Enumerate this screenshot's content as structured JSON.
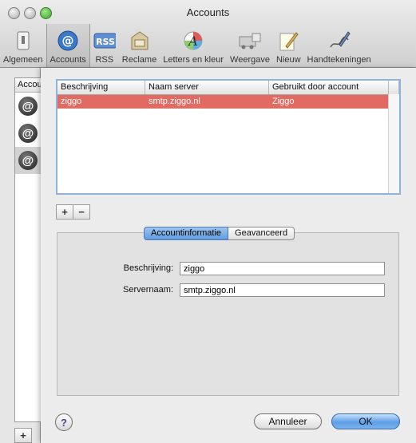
{
  "window": {
    "title": "Accounts"
  },
  "toolbar": {
    "items": [
      {
        "label": "Algemeen",
        "icon": "switch-icon"
      },
      {
        "label": "Accounts",
        "icon": "at-sign-icon"
      },
      {
        "label": "RSS",
        "icon": "rss-icon"
      },
      {
        "label": "Reclame",
        "icon": "junk-mail-icon"
      },
      {
        "label": "Letters en kleur",
        "icon": "fonts-colors-icon"
      },
      {
        "label": "Weergave",
        "icon": "viewing-icon"
      },
      {
        "label": "Nieuw",
        "icon": "composing-icon"
      },
      {
        "label": "Handtekeningen",
        "icon": "signature-icon"
      }
    ],
    "active": "Accounts"
  },
  "sidebar": {
    "header": "Accou",
    "add_label": "+"
  },
  "server_table": {
    "columns": [
      "Beschrijving",
      "Naam server",
      "Gebruikt door account"
    ],
    "rows": [
      {
        "description": "ziggo",
        "server": "smtp.ziggo.nl",
        "account": "Ziggo"
      }
    ],
    "selected_color": "#e16a63"
  },
  "list_buttons": {
    "add": "+",
    "remove": "−"
  },
  "tabs": {
    "info": "Accountinformatie",
    "advanced": "Geavanceerd"
  },
  "form": {
    "description_label": "Beschrijving:",
    "description_value": "ziggo",
    "server_label": "Servernaam:",
    "server_value": "smtp.ziggo.nl"
  },
  "buttons": {
    "help": "?",
    "cancel": "Annuleer",
    "ok": "OK"
  }
}
